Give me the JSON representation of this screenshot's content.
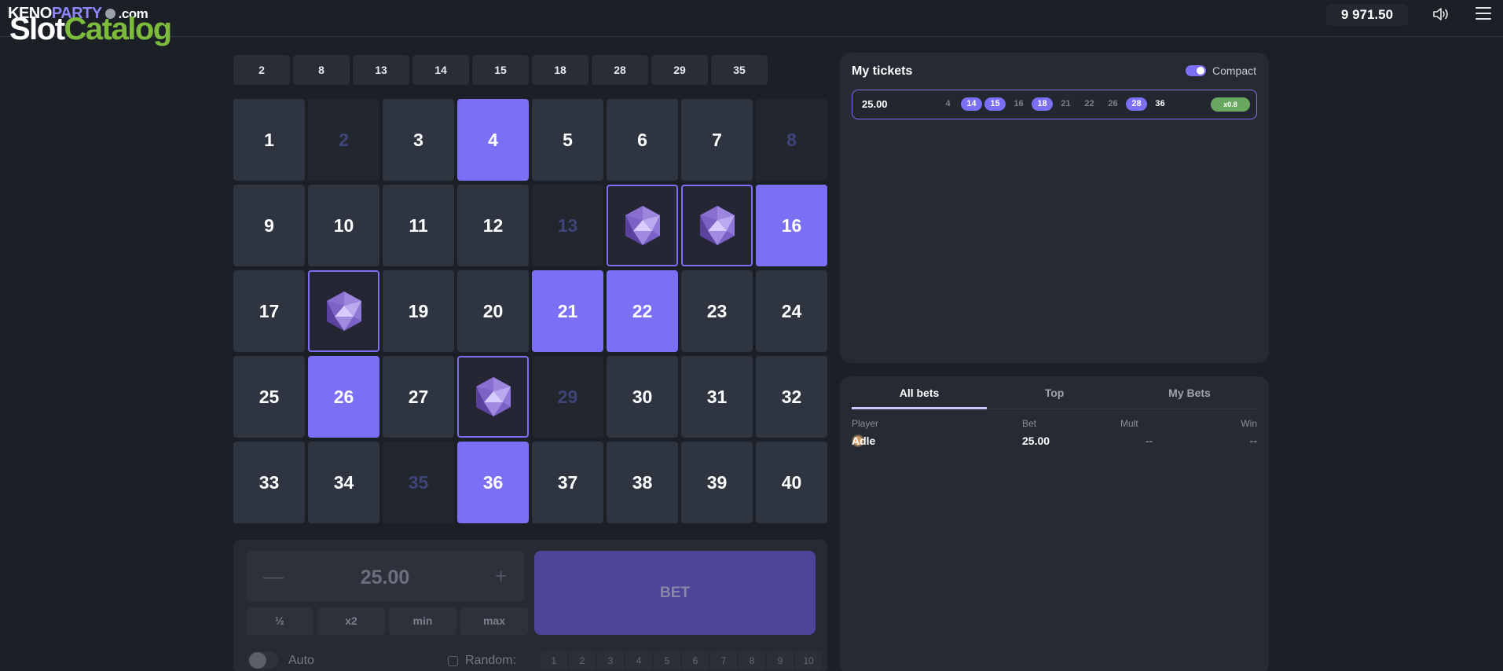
{
  "header": {
    "logo": {
      "keno": "KENO",
      "party": "PARTY",
      "com": ".com",
      "slot": "Slot",
      "catalog": "Catalog"
    },
    "balance": "9 971.50",
    "icons": {
      "sound": "sound-icon",
      "menu": "menu-icon"
    }
  },
  "drawn_numbers": [
    "2",
    "8",
    "13",
    "14",
    "15",
    "18",
    "28",
    "29",
    "35"
  ],
  "grid": {
    "cells": [
      {
        "n": "1",
        "state": "normal"
      },
      {
        "n": "2",
        "state": "dim"
      },
      {
        "n": "3",
        "state": "normal"
      },
      {
        "n": "4",
        "state": "selected"
      },
      {
        "n": "5",
        "state": "normal"
      },
      {
        "n": "6",
        "state": "normal"
      },
      {
        "n": "7",
        "state": "normal"
      },
      {
        "n": "8",
        "state": "dim"
      },
      {
        "n": "9",
        "state": "normal"
      },
      {
        "n": "10",
        "state": "normal"
      },
      {
        "n": "11",
        "state": "normal"
      },
      {
        "n": "12",
        "state": "normal"
      },
      {
        "n": "13",
        "state": "dim"
      },
      {
        "n": "14",
        "state": "gem"
      },
      {
        "n": "15",
        "state": "gem"
      },
      {
        "n": "16",
        "state": "selected"
      },
      {
        "n": "17",
        "state": "normal"
      },
      {
        "n": "18",
        "state": "gem"
      },
      {
        "n": "19",
        "state": "normal"
      },
      {
        "n": "20",
        "state": "normal"
      },
      {
        "n": "21",
        "state": "selected"
      },
      {
        "n": "22",
        "state": "selected"
      },
      {
        "n": "23",
        "state": "normal"
      },
      {
        "n": "24",
        "state": "normal"
      },
      {
        "n": "25",
        "state": "normal"
      },
      {
        "n": "26",
        "state": "selected"
      },
      {
        "n": "27",
        "state": "normal"
      },
      {
        "n": "28",
        "state": "gem"
      },
      {
        "n": "29",
        "state": "dim"
      },
      {
        "n": "30",
        "state": "normal"
      },
      {
        "n": "31",
        "state": "normal"
      },
      {
        "n": "32",
        "state": "normal"
      },
      {
        "n": "33",
        "state": "normal"
      },
      {
        "n": "34",
        "state": "normal"
      },
      {
        "n": "35",
        "state": "dim"
      },
      {
        "n": "36",
        "state": "selected"
      },
      {
        "n": "37",
        "state": "normal"
      },
      {
        "n": "38",
        "state": "normal"
      },
      {
        "n": "39",
        "state": "normal"
      },
      {
        "n": "40",
        "state": "normal"
      }
    ],
    "gem_icon": "gem-icon"
  },
  "controls": {
    "stake_value": "25.00",
    "minus_symbol": "—",
    "plus_symbol": "+",
    "quick": [
      "½",
      "x2",
      "min",
      "max"
    ],
    "bet_label": "BET",
    "auto_label": "Auto",
    "random_label": "Random:",
    "random_numbers": [
      "1",
      "2",
      "3",
      "4",
      "5",
      "6",
      "7",
      "8",
      "9",
      "10"
    ]
  },
  "tickets": {
    "title": "My tickets",
    "compact_label": "Compact",
    "ticket": {
      "amount": "25.00",
      "numbers": [
        {
          "n": "4",
          "state": "plain"
        },
        {
          "n": "14",
          "state": "hit"
        },
        {
          "n": "15",
          "state": "hit"
        },
        {
          "n": "16",
          "state": "plain"
        },
        {
          "n": "18",
          "state": "hit"
        },
        {
          "n": "21",
          "state": "plain"
        },
        {
          "n": "22",
          "state": "plain"
        },
        {
          "n": "26",
          "state": "plain"
        },
        {
          "n": "28",
          "state": "hit"
        },
        {
          "n": "36",
          "state": "sel"
        }
      ],
      "multiplier": "x0.8"
    }
  },
  "bets": {
    "tabs": [
      "All bets",
      "Top",
      "My Bets"
    ],
    "active_tab": 0,
    "columns": {
      "player": "Player",
      "bet": "Bet",
      "mult": "Mult",
      "win": "Win"
    },
    "rows": [
      {
        "player": "Adle",
        "bet": "25.00",
        "mult": "--",
        "win": "--"
      }
    ]
  },
  "colors": {
    "background": "#1b1f26",
    "accent": "#7a6ff5",
    "cell": "#2f3540",
    "bet_button": "#4c4598",
    "win_badge": "#6aa860"
  }
}
